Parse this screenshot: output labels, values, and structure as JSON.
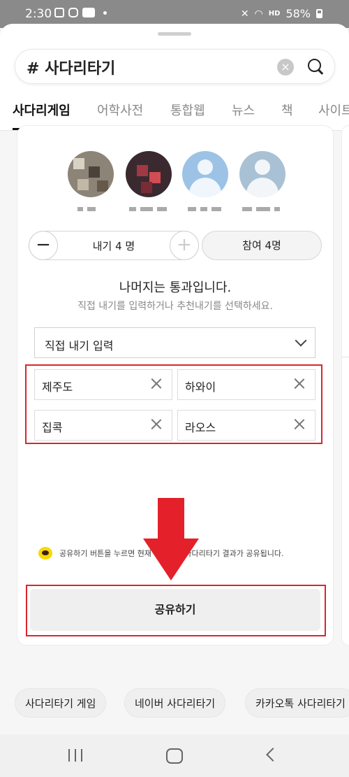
{
  "status_bar": {
    "time": "2:30",
    "battery": "58%",
    "icons": [
      "gallery-icon",
      "instagram-icon",
      "blog-icon",
      "mute-icon",
      "wifi-icon",
      "hd-voice-icon",
      "battery-icon"
    ]
  },
  "search": {
    "query": "# 사다리타기"
  },
  "tabs": [
    {
      "label": "사다리게임",
      "active": true
    },
    {
      "label": "어학사전"
    },
    {
      "label": "통합웹"
    },
    {
      "label": "뉴스"
    },
    {
      "label": "책"
    },
    {
      "label": "사이트"
    }
  ],
  "game": {
    "stake_count": "내기 4 명",
    "participant_count": "참여 4명",
    "headline": "나머지는 통과입니다.",
    "subline": "직접 내기를 입력하거나 추천내기를 선택하세요.",
    "dropdown_value": "직접 내기 입력",
    "items": [
      "제주도",
      "하와이",
      "집콕",
      "라오스"
    ],
    "notice": "공유하기 버튼을 누르면 현재 대화방에 사다리타기 결과가 공유됩니다.",
    "share_label": "공유하기"
  },
  "chips": [
    "사다리타기 게임",
    "네이버 사다리타기",
    "카카오톡 사다리타기"
  ],
  "colors": {
    "highlight_red": "#d9262c",
    "arrow_red": "#e4202a",
    "kakao_yellow": "#f7d900"
  }
}
